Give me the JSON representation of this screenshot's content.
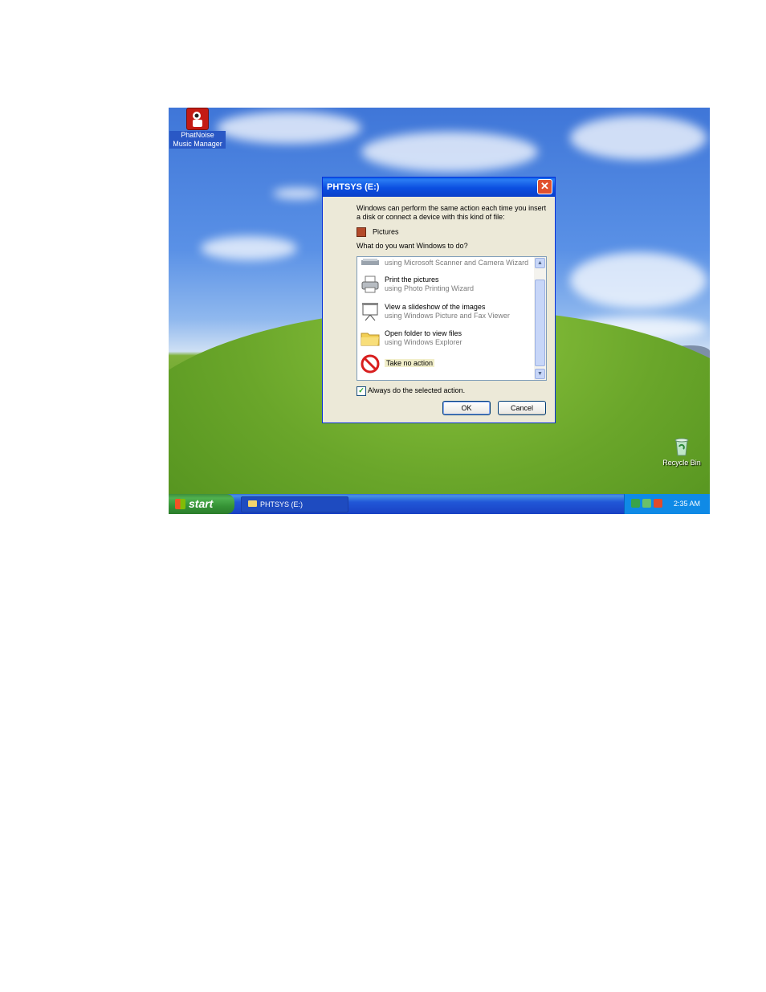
{
  "desktop": {
    "icons": [
      {
        "label_line1": "PhatNoise",
        "label_line2": "Music Manager"
      },
      {
        "label_line1": "Recycle Bin"
      }
    ]
  },
  "dialog": {
    "title": "PHTSYS (E:)",
    "intro": "Windows can perform the same action each time you insert a disk or connect a device with this kind of file:",
    "content_type": "Pictures",
    "question": "What do you want Windows to do?",
    "actions": [
      {
        "title": "",
        "subtitle": "using Microsoft Scanner and Camera Wizard",
        "icon": "scanner-icon"
      },
      {
        "title": "Print the pictures",
        "subtitle": "using Photo Printing Wizard",
        "icon": "printer-icon"
      },
      {
        "title": "View a slideshow of the images",
        "subtitle": "using Windows Picture and Fax Viewer",
        "icon": "slideshow-icon"
      },
      {
        "title": "Open folder to view files",
        "subtitle": "using Windows Explorer",
        "icon": "folder-icon"
      },
      {
        "title": "Take no action",
        "subtitle": "",
        "icon": "no-action-icon"
      }
    ],
    "always_label": "Always do the selected action.",
    "always_checked": true,
    "ok_label": "OK",
    "cancel_label": "Cancel"
  },
  "taskbar": {
    "start_label": "start",
    "task_label": "PHTSYS (E:)",
    "clock": "2:35 AM"
  },
  "colors": {
    "titlebar": "#0a4fe0",
    "taskbar": "#2157d7",
    "start_button": "#369336",
    "no_action_red": "#d81e1e"
  }
}
